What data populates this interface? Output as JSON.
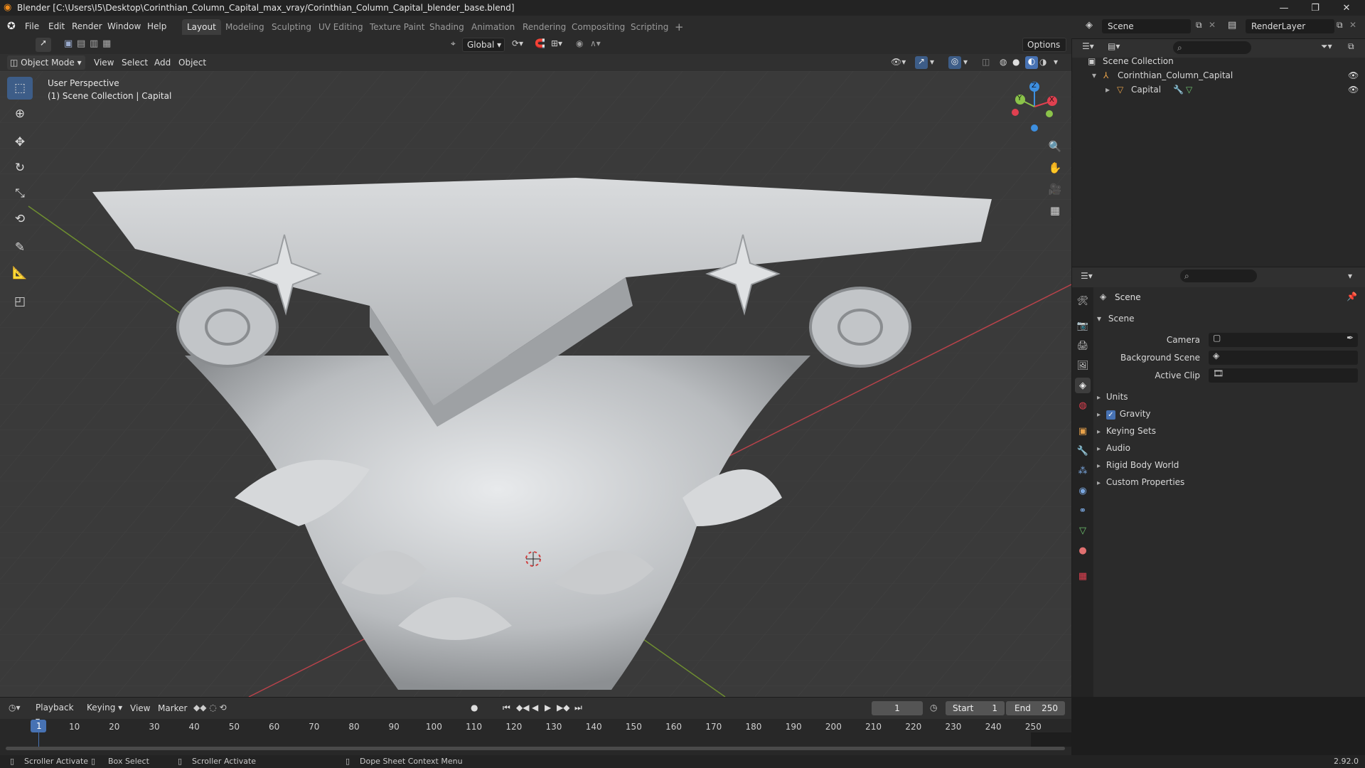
{
  "window": {
    "title": "Blender [C:\\Users\\I5\\Desktop\\Corinthian_Column_Capital_max_vray/Corinthian_Column_Capital_blender_base.blend]"
  },
  "menus": [
    "File",
    "Edit",
    "Render",
    "Window",
    "Help"
  ],
  "workspaces": [
    "Layout",
    "Modeling",
    "Sculpting",
    "UV Editing",
    "Texture Paint",
    "Shading",
    "Animation",
    "Rendering",
    "Compositing",
    "Scripting"
  ],
  "active_workspace": "Layout",
  "scene_field": "Scene",
  "renderlayer_field": "RenderLayer",
  "header": {
    "transform": "Global",
    "options": "Options"
  },
  "viewport_header": {
    "mode": "Object Mode",
    "menus": [
      "View",
      "Select",
      "Add",
      "Object"
    ]
  },
  "viewport": {
    "perspective": "User Perspective",
    "collection": "(1) Scene Collection | Capital",
    "axes": {
      "x": "X",
      "y": "Y",
      "z": "Z"
    }
  },
  "outliner": {
    "root": "Scene Collection",
    "collection": "Corinthian_Column_Capital",
    "object": "Capital"
  },
  "properties": {
    "context": "Scene",
    "panel": "Scene",
    "fields": {
      "camera": "Camera",
      "background_scene": "Background Scene",
      "active_clip": "Active Clip"
    },
    "sections": [
      "Units",
      "Gravity",
      "Keying Sets",
      "Audio",
      "Rigid Body World",
      "Custom Properties"
    ],
    "gravity_checked": true
  },
  "timeline": {
    "menus": [
      "Playback",
      "Keying",
      "View",
      "Marker"
    ],
    "current_frame": "1",
    "start_label": "Start",
    "start": "1",
    "end_label": "End",
    "end": "250",
    "ticks": [
      "1",
      "10",
      "20",
      "30",
      "40",
      "50",
      "60",
      "70",
      "80",
      "90",
      "100",
      "110",
      "120",
      "130",
      "140",
      "150",
      "160",
      "170",
      "180",
      "190",
      "200",
      "210",
      "220",
      "230",
      "240",
      "250"
    ]
  },
  "statusbar": {
    "items": [
      "Scroller Activate",
      "Box Select",
      "Scroller Activate",
      "Dope Sheet Context Menu"
    ],
    "version": "2.92.0"
  },
  "colors": {
    "accent": "#4772b3",
    "bg": "#3a3a3a",
    "panel": "#2b2b2b",
    "x_axis": "#e04050",
    "y_axis": "#8bc34a",
    "z_axis": "#3d8fe0"
  }
}
